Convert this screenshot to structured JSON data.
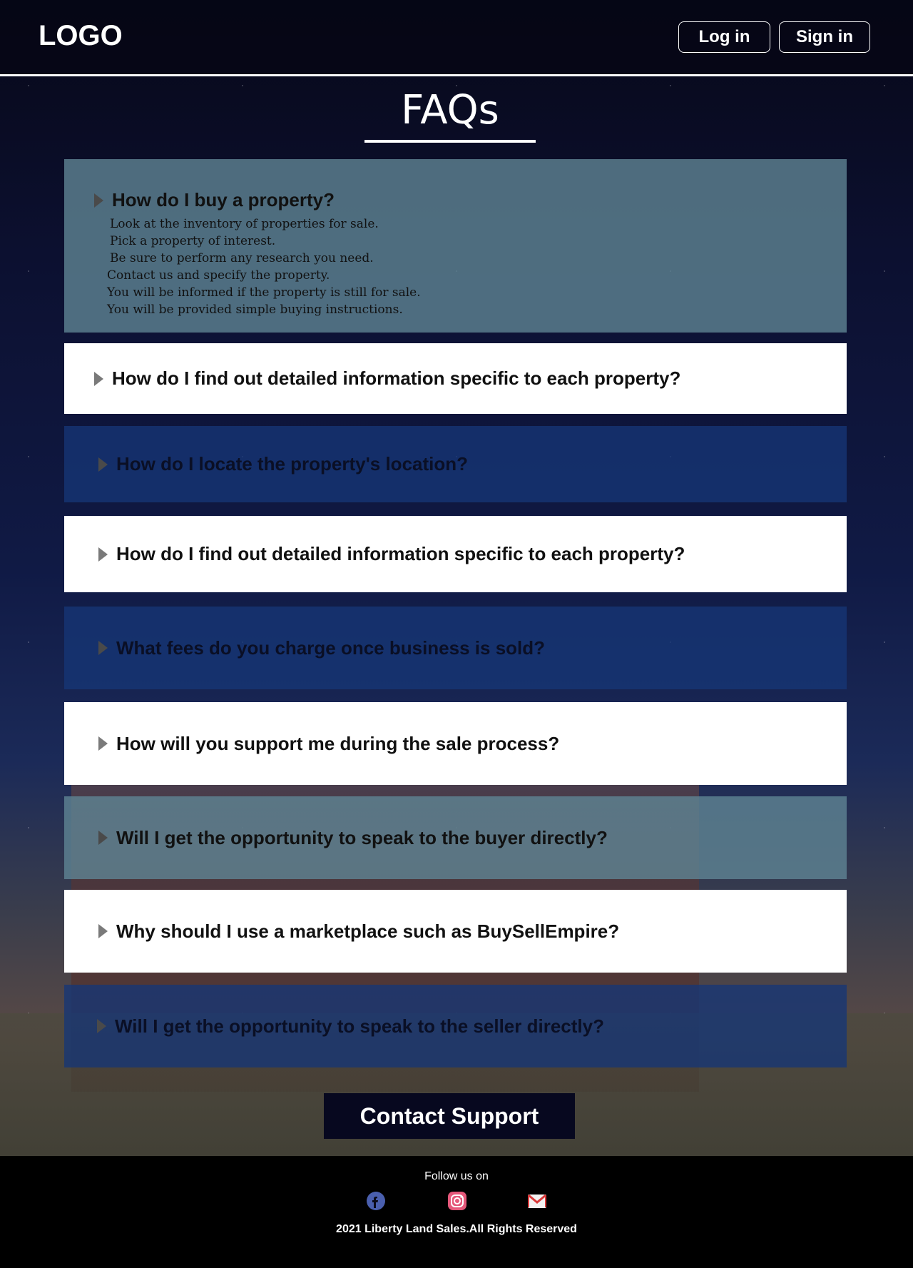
{
  "header": {
    "logo": "LOGO",
    "login_label": "Log in",
    "signin_label": "Sign in"
  },
  "page_title": "FAQs",
  "faqs": [
    {
      "question": "How do I buy a property?",
      "expanded": true,
      "answer": [
        "Look at the inventory of properties for sale.",
        "Pick a property of interest.",
        "Be sure to perform any research you need.",
        "Contact us and specify the property.",
        "You will be informed if the property is still for sale.",
        "You will be provided simple buying instructions."
      ]
    },
    {
      "question": "How do I find out detailed information specific to each property?"
    },
    {
      "question": "How do I locate the property's location?"
    },
    {
      "question": "How do I find out detailed information specific to each property?"
    },
    {
      "question": "What fees do you charge once business is sold?"
    },
    {
      "question": "How will you support me during the sale process?"
    },
    {
      "question": "Will I get the opportunity to speak to the buyer directly?"
    },
    {
      "question": "Why should I use a marketplace such as BuySellEmpire?"
    },
    {
      "question": "Will I get the opportunity to speak to the seller directly?"
    }
  ],
  "contact_button": "Contact  Support",
  "footer": {
    "follow_text": "Follow us on",
    "social_icons": [
      "facebook-icon",
      "instagram-icon",
      "mail-icon"
    ],
    "copyright": "2021  Liberty  Land Sales.All Rights Reserved"
  },
  "colors": {
    "header_bg": "#070818",
    "faq_white": "#ffffff",
    "faq_blue": "#163676",
    "faq_teal": "#5f8494",
    "contact_bg": "#07081f",
    "footer_bg": "#000000"
  }
}
